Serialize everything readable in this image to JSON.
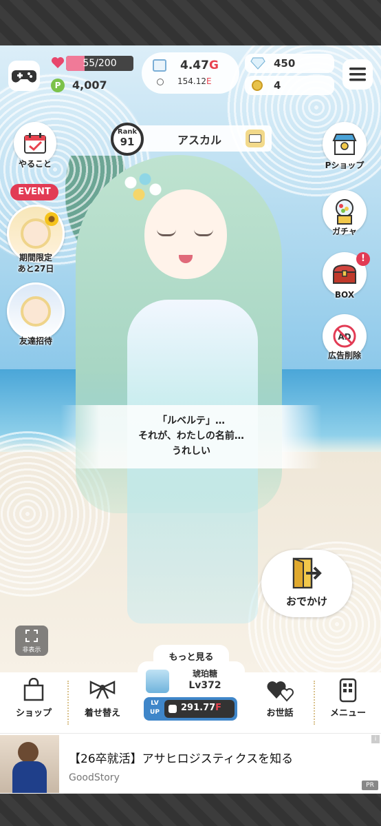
{
  "hud": {
    "hp_text": "55/200",
    "hp_fraction": 0.275,
    "points": "4,007",
    "gold_value": "4.47",
    "gold_unit": "G",
    "energy_value": "154.12",
    "energy_unit": "E",
    "gems": "450",
    "coins": "4"
  },
  "left_menu": {
    "todo_label": "やること",
    "event_tag": "EVENT",
    "limited_label_1": "期間限定",
    "limited_label_2": "あと27日",
    "invite_label": "友達招待"
  },
  "rank": {
    "label": "Rank",
    "value": "91",
    "name": "アスカル"
  },
  "right_menu": {
    "pshop_label": "Pショップ",
    "gacha_label": "ガチャ",
    "box_label": "BOX",
    "box_badge": "!",
    "noads_label": "広告削除"
  },
  "dialog": {
    "line1": "「ルベルテ」…",
    "line2": "それが、わたしの名前…",
    "line3": "うれしい"
  },
  "outing_label": "おでかけ",
  "hide_label": "非表示",
  "more_label": "もっと見る",
  "nav": {
    "shop": "ショップ",
    "dressup": "着せ替え",
    "care": "お世話",
    "menu": "メニュー",
    "item_name": "琥珀糖",
    "item_level": "Lv372",
    "lvup_label_1": "LV",
    "lvup_label_2": "UP",
    "lvup_cost": "291.77",
    "lvup_unit": "F"
  },
  "ad": {
    "title": "【26卒就活】アサヒロジスティクスを知る",
    "source": "GoodStory",
    "pr": "PR",
    "info": "i"
  },
  "colors": {
    "hp_pink": "#f07a98",
    "gold_red": "#e8424e",
    "event_red": "#e23b54",
    "lvup_blue": "#3f86c9"
  }
}
